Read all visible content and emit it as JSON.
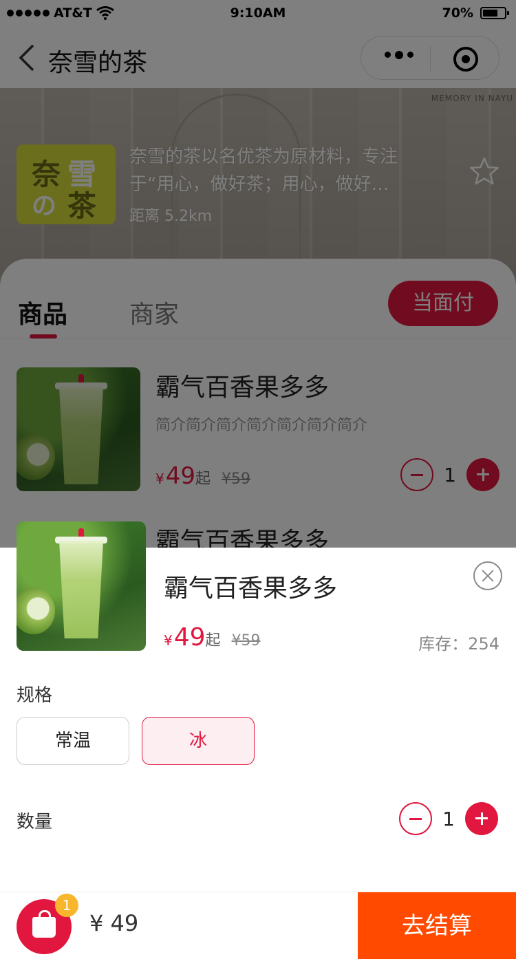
{
  "status_bar": {
    "carrier": "AT&T",
    "time": "9:10AM",
    "battery": "70%"
  },
  "nav": {
    "title": "奈雪的茶",
    "back_icon": "chevron-left-icon",
    "more_icon": "more-dots-icon",
    "target_icon": "target-icon"
  },
  "store": {
    "logo_chars": [
      "奈",
      "雪",
      "の",
      "茶"
    ],
    "description": "奈雪的茶以名优茶为原材料，专注于“用心，做好茶；用心，做好…",
    "distance": "距离 5.2km",
    "bg_text": "MEMORY IN NAYU"
  },
  "tabs": [
    {
      "label": "商品",
      "active": true
    },
    {
      "label": "商家",
      "active": false
    }
  ],
  "pay_button": "当面付",
  "products": [
    {
      "name": "霸气百香果多多",
      "intro": "简介简介简介简介简介简介简介",
      "price_symbol": "¥",
      "price": "49",
      "price_suffix": "起",
      "original_price": "¥59",
      "quantity": "1"
    },
    {
      "name": "霸气百香果多多"
    }
  ],
  "sheet": {
    "name": "霸气百香果多多",
    "price_symbol": "¥",
    "price": "49",
    "price_suffix": "起",
    "original_price": "¥59",
    "stock": "库存：254",
    "spec_label": "规格",
    "spec_options": [
      {
        "label": "常温",
        "selected": false
      },
      {
        "label": "冰",
        "selected": true
      }
    ],
    "qty_label": "数量",
    "quantity": "1"
  },
  "bottom_bar": {
    "badge": "1",
    "total": "¥ 49",
    "checkout": "去结算"
  },
  "colors": {
    "accent": "#e2173f",
    "checkout": "#ff4a00",
    "badge": "#f8b62d",
    "logo": "#d7df3a"
  }
}
